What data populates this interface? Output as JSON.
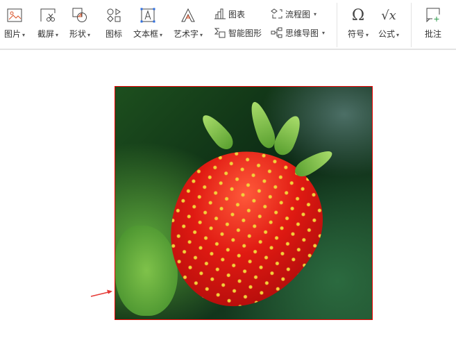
{
  "toolbar": {
    "picture": "图片",
    "screenshot": "截屏",
    "shape": "形状",
    "icon": "图标",
    "textbox": "文本框",
    "wordart": "艺术字",
    "chart": "图表",
    "smartart": "智能图形",
    "flowchart": "流程图",
    "mindmap": "思维导图",
    "symbol": "符号",
    "formula": "公式",
    "comment": "批注",
    "caret": "⌄"
  },
  "colors": {
    "selection_border": "#e00000",
    "arrow": "#e53935",
    "icon_accent": "#d9532a"
  }
}
